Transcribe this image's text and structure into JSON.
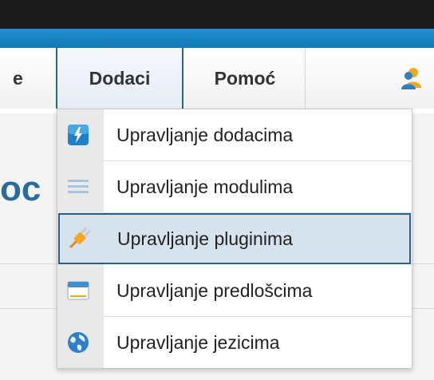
{
  "menubar": {
    "items": [
      {
        "label": "e"
      },
      {
        "label": "Dodaci"
      },
      {
        "label": "Pomoć"
      }
    ]
  },
  "heading_fragment": "oc",
  "dropdown": {
    "items": [
      {
        "label": "Upravljanje dodacima",
        "icon": "extension-manager-icon"
      },
      {
        "label": "Upravljanje modulima",
        "icon": "module-manager-icon"
      },
      {
        "label": "Upravljanje pluginima",
        "icon": "plugin-manager-icon"
      },
      {
        "label": "Upravljanje predlošcima",
        "icon": "template-manager-icon"
      },
      {
        "label": "Upravljanje jezicima",
        "icon": "language-manager-icon"
      }
    ],
    "highlighted_index": 2
  },
  "colors": {
    "top_bar": "#1b1b1b",
    "blue_bar": "#1782c4",
    "heading": "#2b6a9c",
    "highlight_bg": "#d6e2ed",
    "highlight_border": "#2a5f8a"
  }
}
